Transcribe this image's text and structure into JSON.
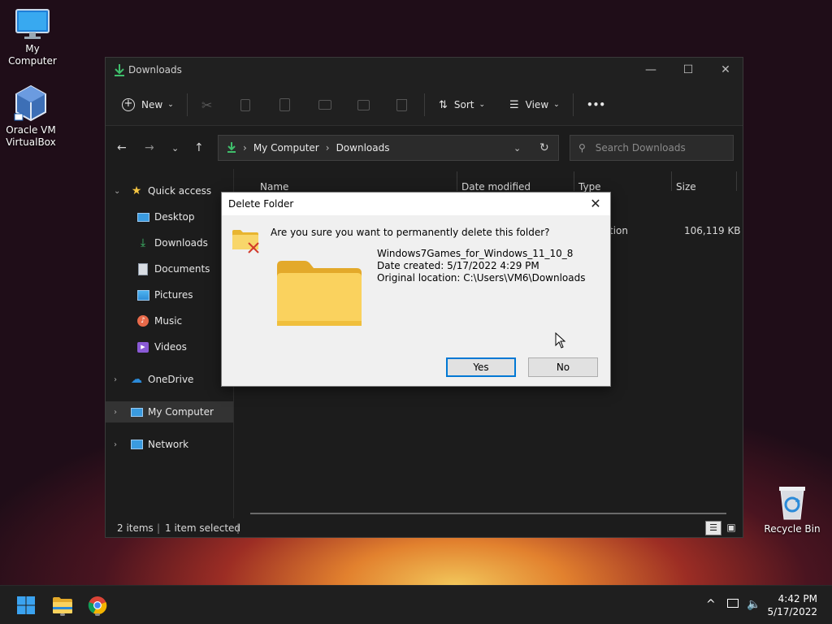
{
  "desktop": {
    "icons": [
      {
        "label": "My Computer",
        "icon": "monitor-icon"
      },
      {
        "label": "Oracle VM VirtualBox",
        "icon": "virtualbox-icon"
      },
      {
        "label": "Recycle Bin",
        "icon": "recycle-bin-icon"
      }
    ]
  },
  "explorer": {
    "title": "Downloads",
    "toolbar": {
      "new_label": "New",
      "sort_label": "Sort",
      "view_label": "View",
      "more_label": "•••"
    },
    "address": {
      "root": "My Computer",
      "current": "Downloads"
    },
    "search": {
      "placeholder": "Search Downloads"
    },
    "nav": {
      "quick_access": "Quick access",
      "items": [
        "Desktop",
        "Downloads",
        "Documents",
        "Pictures",
        "Music",
        "Videos"
      ],
      "onedrive": "OneDrive",
      "my_computer": "My Computer",
      "network": "Network"
    },
    "columns": {
      "name": "Name",
      "date": "Date modified",
      "type": "Type",
      "size": "Size"
    },
    "row": {
      "type_partial": "tion",
      "size": "106,119 KB"
    },
    "status": {
      "items": "2 items",
      "selected": "1 item selected"
    }
  },
  "dialog": {
    "title": "Delete Folder",
    "question": "Are you sure you want to permanently delete this folder?",
    "folder_name": "Windows7Games_for_Windows_11_10_8",
    "date_created": "Date created: 5/17/2022 4:29 PM",
    "original_location": "Original location: C:\\Users\\VM6\\Downloads",
    "yes_label": "Yes",
    "no_label": "No",
    "close_label": "✕"
  },
  "taskbar": {
    "time": "4:42 PM",
    "date": "5/17/2022",
    "tray_chevron": "^"
  },
  "colors": {
    "accent": "#0078d4",
    "folder": "#f8c93f"
  }
}
